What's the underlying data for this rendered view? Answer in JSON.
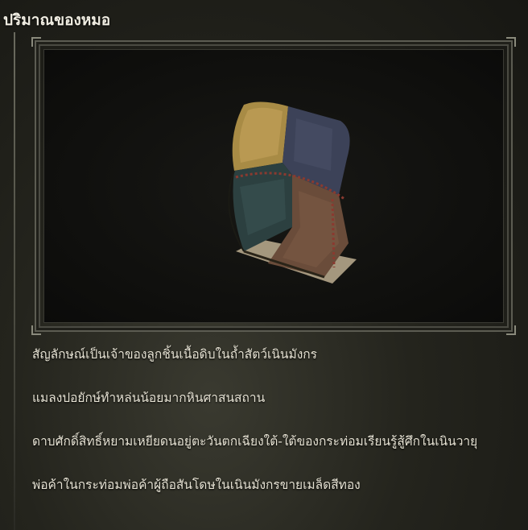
{
  "item": {
    "name": "ปริมาณของหมอ",
    "icon": "cloth-pouch-icon"
  },
  "description": [
    "สัญลักษณ์เป็นเจ้าของลูกชิ้นเนื้อดิบในถ้ำสัตว์เนินมังกร",
    "แมลงปอยักษ์ทำหล่นน้อยมากหินศาสนสถาน",
    "ดาบศักดิ์สิทธิ์หยามเหยียดนอยู่ตะวันตกเฉียงใต้-ใต้ของกระท่อมเรียนรู้สู้ศึกในเนินวายุ",
    "พ่อค้าในกระท่อมพ่อค้าผู้ถือสันโดษในเนินมังกรขายเมล็ดสีทอง"
  ]
}
